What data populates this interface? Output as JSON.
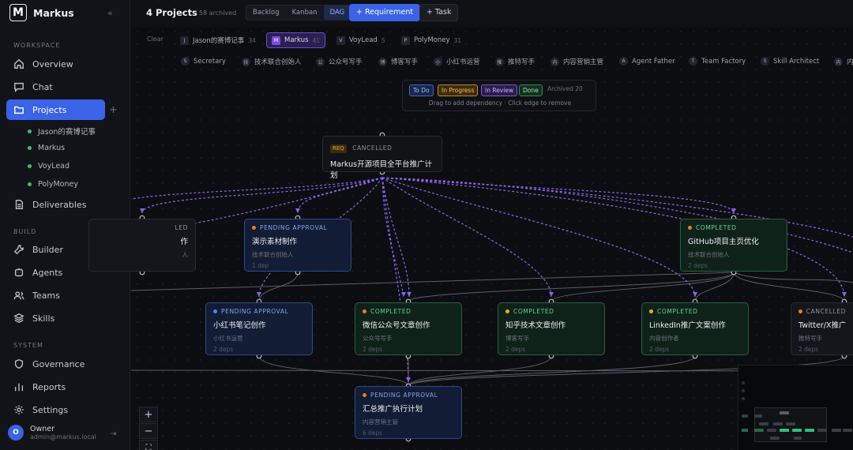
{
  "app": {
    "name": "Markus",
    "logo_letter": "M"
  },
  "sidebar": {
    "sections": {
      "workspace": "WORKSPACE",
      "build": "BUILD",
      "system": "SYSTEM"
    },
    "items": {
      "overview": "Overview",
      "chat": "Chat",
      "projects": "Projects",
      "deliverables": "Deliverables",
      "builder": "Builder",
      "agents": "Agents",
      "teams": "Teams",
      "skills": "Skills",
      "governance": "Governance",
      "reports": "Reports",
      "settings": "Settings"
    },
    "project_list": [
      "Jason的赛博记事",
      "Markus",
      "VoyLead",
      "PolyMoney"
    ],
    "user": {
      "name": "Owner",
      "email": "admin@markus.local",
      "initial": "O"
    }
  },
  "header": {
    "title": "4 Projects",
    "archived": "58 archived",
    "views": [
      "Backlog",
      "Kanban",
      "DAG"
    ],
    "active_view": "DAG",
    "add_requirement": "+ Requirement",
    "add_task": "+ Task"
  },
  "project_filter": {
    "clear": "Clear",
    "tabs": [
      {
        "letter": "J",
        "name": "Jason的赛博记事",
        "count": "34"
      },
      {
        "letter": "M",
        "name": "Markus",
        "count": "41"
      },
      {
        "letter": "V",
        "name": "VoyLead",
        "count": "5"
      },
      {
        "letter": "P",
        "name": "PolyMoney",
        "count": "31"
      }
    ]
  },
  "agents": [
    {
      "letter": "S",
      "name": "Secretary"
    },
    {
      "letter": "技",
      "name": "技术联合创始人"
    },
    {
      "letter": "公",
      "name": "公众号写手"
    },
    {
      "letter": "博",
      "name": "博客写手"
    },
    {
      "letter": "小",
      "name": "小红书运营"
    },
    {
      "letter": "推",
      "name": "推特写手"
    },
    {
      "letter": "内",
      "name": "内容营销主管"
    },
    {
      "letter": "A",
      "name": "Agent Father"
    },
    {
      "letter": "T",
      "name": "Team Factory"
    },
    {
      "letter": "S",
      "name": "Skill Architect"
    },
    {
      "letter": "内",
      "name": "内"
    }
  ],
  "legend": {
    "todo": "To Do",
    "in_progress": "In Progress",
    "in_review": "In Review",
    "done": "Done",
    "archived": "Archived 20",
    "hint": "Drag to add dependency · Click edge to remove"
  },
  "requirement": {
    "tag": "REQ",
    "status": "CANCELLED",
    "title": "Markus开源项目全平台推广计划"
  },
  "nodes": {
    "left_partial": {
      "status": "LED",
      "title": "作",
      "agent": "人"
    },
    "materials": {
      "status": "PENDING APPROVAL",
      "title": "演示素材制作",
      "agent": "技术联合创始人",
      "deps": "1 dep"
    },
    "github": {
      "status": "COMPLETED",
      "title": "GitHub项目主页优化",
      "agent": "技术联合创始人",
      "deps": "2 deps"
    },
    "xiaohongshu": {
      "status": "PENDING APPROVAL",
      "title": "小红书笔记创作",
      "agent": "小红书运营",
      "deps": "2 deps"
    },
    "wechat": {
      "status": "COMPLETED",
      "title": "微信公众号文章创作",
      "agent": "公众号写手",
      "deps": "2 deps"
    },
    "zhihu": {
      "status": "COMPLETED",
      "title": "知乎技术文章创作",
      "agent": "博客写手",
      "deps": "2 deps"
    },
    "linkedin": {
      "status": "COMPLETED",
      "title": "LinkedIn推广文案创作",
      "agent": "内容创作者",
      "deps": "2 deps"
    },
    "twitter": {
      "status": "CANCELLED",
      "title": "Twitter/X推广文",
      "agent": "推特写手",
      "deps": "2 deps"
    },
    "summary": {
      "status": "PENDING APPROVAL",
      "title": "汇总推广执行计划",
      "agent": "内容营销主管",
      "deps": "6 deps"
    }
  },
  "zoom": {
    "in": "+",
    "out": "−",
    "fit": "⛶"
  },
  "colors": {
    "accent": "#3a63e8",
    "pending": "#2d4a8d",
    "completed": "#24613f",
    "edge_dep": "#8a63e8"
  }
}
